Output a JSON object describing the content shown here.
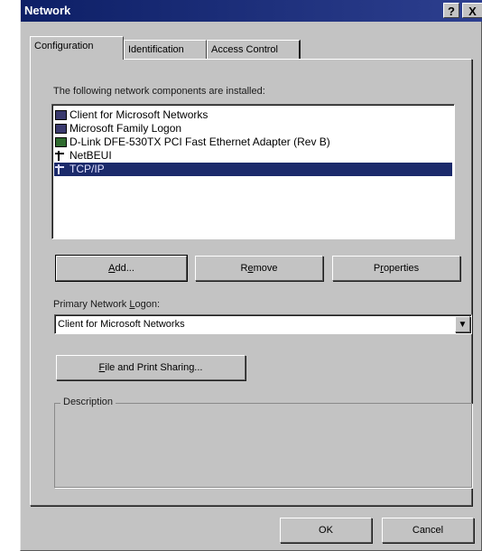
{
  "window": {
    "title": "Network",
    "help_glyph": "?",
    "close_glyph": "X"
  },
  "tabs": [
    {
      "label": "Configuration",
      "active": true
    },
    {
      "label": "Identification",
      "active": false
    },
    {
      "label": "Access Control",
      "active": false
    }
  ],
  "components": {
    "intro": "The following network components are installed:",
    "intro_underline_char": "n",
    "items": [
      {
        "label": "Client for Microsoft Networks",
        "icon": "client-icon",
        "selected": false
      },
      {
        "label": "Microsoft Family Logon",
        "icon": "client-icon",
        "selected": false
      },
      {
        "label": "D-Link DFE-530TX PCI Fast Ethernet Adapter (Rev B)",
        "icon": "network-adapter-icon",
        "selected": false
      },
      {
        "label": "NetBEUI",
        "icon": "protocol-icon",
        "selected": false
      },
      {
        "label": "TCP/IP",
        "icon": "protocol-icon",
        "selected": true
      }
    ]
  },
  "buttons": {
    "add": {
      "pre": "",
      "key": "A",
      "post": "dd..."
    },
    "remove": {
      "pre": "R",
      "key": "e",
      "post": "move"
    },
    "properties": {
      "pre": "P",
      "key": "r",
      "post": "operties"
    },
    "file_print": {
      "pre": "",
      "key": "F",
      "post": "ile and Print Sharing..."
    },
    "ok": "OK",
    "cancel": "Cancel"
  },
  "logon": {
    "label_pre": "Primary Network ",
    "label_key": "L",
    "label_post": "ogon:",
    "value": "Client for Microsoft Networks"
  },
  "description": {
    "title": "Description",
    "text": ""
  },
  "colors": {
    "dialog_face": "#c3c3c3",
    "titlebar": "#0d1f66",
    "selection": "#1b2a6b"
  }
}
